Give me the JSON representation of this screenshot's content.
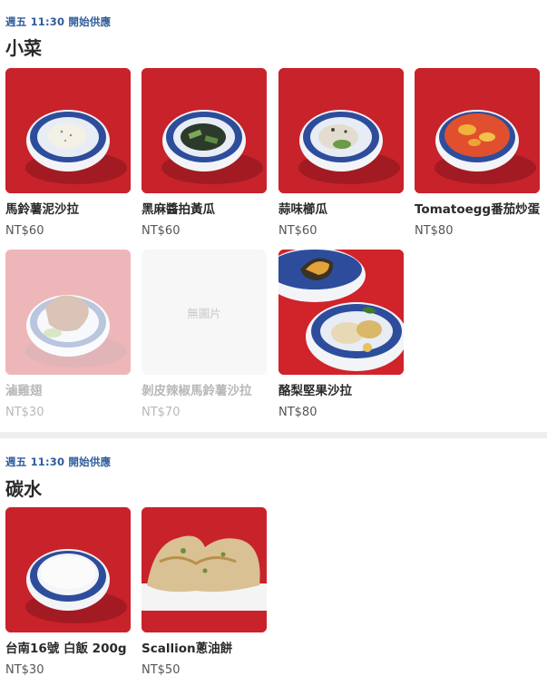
{
  "sections": [
    {
      "serving_time": "週五 11:30 開始供應",
      "title": "小菜",
      "items": [
        {
          "name": "馬鈴薯泥沙拉",
          "price": "NT$60"
        },
        {
          "name": "黑麻醬拍黃瓜",
          "price": "NT$60"
        },
        {
          "name": "蒜味櫛瓜",
          "price": "NT$60"
        },
        {
          "name": "Tomatoegg番茄炒蛋",
          "price": "NT$80"
        },
        {
          "name": "滷雞翅",
          "price": "NT$30"
        },
        {
          "name": "剝皮辣椒馬鈴薯沙拉",
          "price": "NT$70",
          "no_image_text": "無圖片"
        },
        {
          "name": "酪梨堅果沙拉",
          "price": "NT$80"
        }
      ]
    },
    {
      "serving_time": "週五 11:30 開始供應",
      "title": "碳水",
      "items": [
        {
          "name": "台南16號 白飯 200g",
          "price": "NT$30"
        },
        {
          "name": "Scallion蔥油餅",
          "price": "NT$50"
        }
      ]
    }
  ],
  "colors": {
    "accent_blue": "#2f5c9b",
    "photo_red": "#c8222a",
    "disabled_text": "#b8b8b8"
  }
}
